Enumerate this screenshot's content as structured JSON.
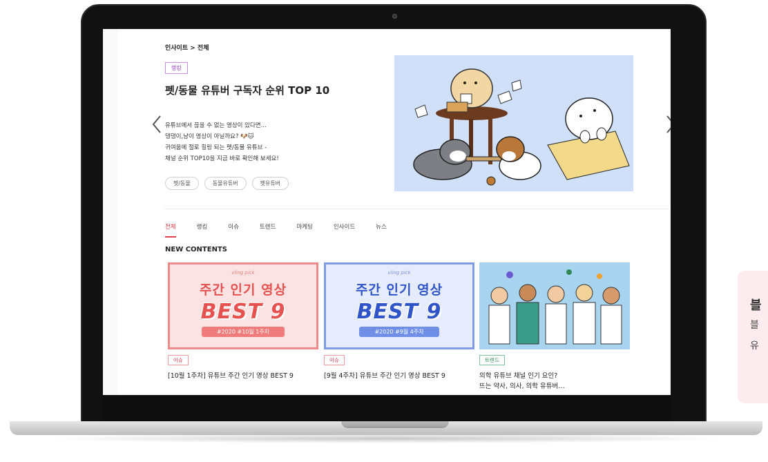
{
  "breadcrumb": "인사이트 > 전체",
  "hero": {
    "category": "랭킹",
    "title": "펫/동물 유튜버 구독자 순위 TOP 10",
    "description": [
      "유튜브에서 끊을 수 없는 영상이 있다면...",
      "댕댕이,냥이 영상이 아닐까요? 🐶🐱",
      "귀여움에 절로 힐링 되는 펫/동물 유튜브 -",
      "채널 순위 TOP10을 지금 바로 확인해 보세요!"
    ],
    "tags": [
      "펫/동물",
      "동물유튜버",
      "펫유튜버"
    ],
    "prev_icon": "chevron-left-icon",
    "next_icon": "chevron-right-icon"
  },
  "tabs": [
    "전체",
    "랭킹",
    "이슈",
    "트렌드",
    "마케팅",
    "인사이드",
    "뉴스"
  ],
  "active_tab": "전체",
  "section_title": "NEW CONTENTS",
  "cards": [
    {
      "brand": "vling pick",
      "headline": "주간 인기 영상",
      "big": "BEST 9",
      "week": "#2020 #10월 1주차",
      "badge": "이슈",
      "title": "[10월 1주차] 유튜브 주간 인기 영상 BEST 9"
    },
    {
      "brand": "vling pick",
      "headline": "주간 인기 영상",
      "big": "BEST 9",
      "week": "#2020 #9월 4주차",
      "badge": "이슈",
      "title": "[9월 4주차] 유튜브 주간 인기 영상 BEST 9"
    },
    {
      "badge": "트렌드",
      "title": "의학 유튜브 채널 인기 요인?",
      "title2": "뜨는 약사, 의사, 의학 유튜버…"
    }
  ],
  "side_panel": {
    "line1": "블",
    "line2": "블",
    "line3": "유"
  },
  "colors": {
    "accent": "#e0404b",
    "ranking": "#9a3bd0",
    "trend": "#2e8b57",
    "card1_bg": "#fbe3e3",
    "card2_bg": "#e6ecfb",
    "card3_bg": "#a9d4ef"
  }
}
